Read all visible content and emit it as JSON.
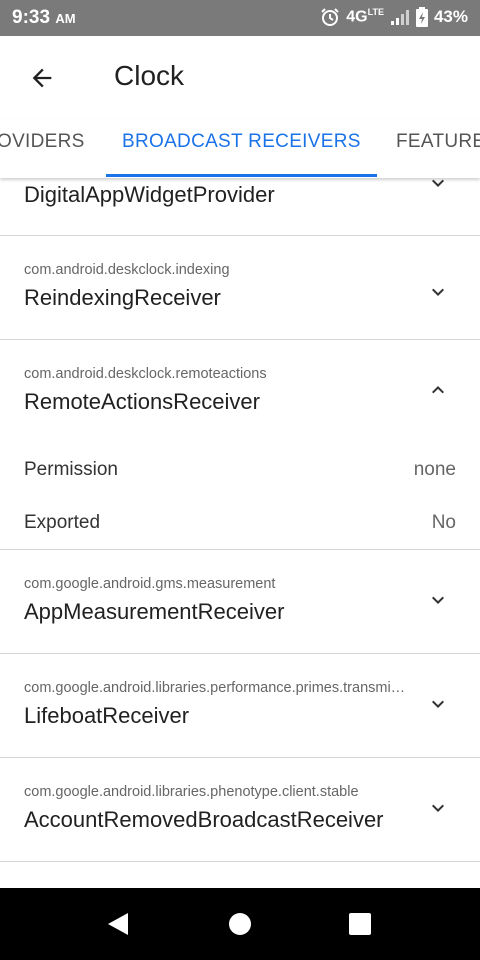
{
  "status": {
    "time": "9:33",
    "ampm": "AM",
    "network": "4G",
    "network_sup": "LTE",
    "battery": "43%",
    "icons": [
      "alarm-icon",
      "signal-icon",
      "battery-icon"
    ]
  },
  "appbar": {
    "title": "Clock",
    "back_icon": "arrow-back-icon"
  },
  "tabs": [
    {
      "label": "PROVIDERS",
      "active": false
    },
    {
      "label": "BROADCAST RECEIVERS",
      "active": true
    },
    {
      "label": "FEATURES",
      "active": false
    }
  ],
  "colors": {
    "accent": "#1a73e8",
    "statusbar": "#7a7a7a"
  },
  "receivers": [
    {
      "package": "",
      "name": "DigitalAppWidgetProvider",
      "expanded": false
    },
    {
      "package": "com.android.deskclock.indexing",
      "name": "ReindexingReceiver",
      "expanded": false
    },
    {
      "package": "com.android.deskclock.remoteactions",
      "name": "RemoteActionsReceiver",
      "expanded": true,
      "details": [
        {
          "label": "Permission",
          "value": "none"
        },
        {
          "label": "Exported",
          "value": "No"
        }
      ]
    },
    {
      "package": "com.google.android.gms.measurement",
      "name": "AppMeasurementReceiver",
      "expanded": false
    },
    {
      "package": "com.google.android.libraries.performance.primes.transmi…",
      "name": "LifeboatReceiver",
      "expanded": false
    },
    {
      "package": "com.google.android.libraries.phenotype.client.stable",
      "name": "AccountRemovedBroadcastReceiver",
      "expanded": false
    }
  ],
  "navbar": {
    "icons": [
      "back-triangle-icon",
      "home-circle-icon",
      "recents-square-icon"
    ]
  }
}
